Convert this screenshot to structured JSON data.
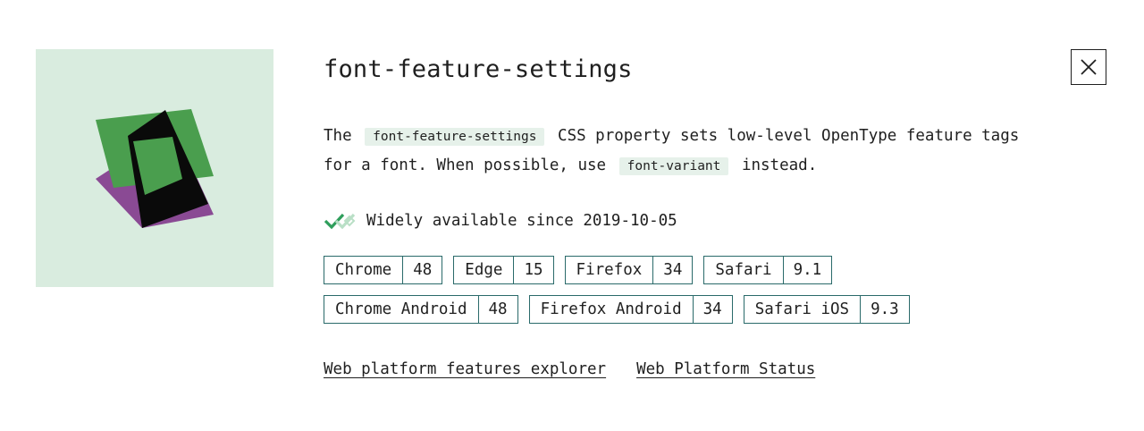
{
  "title": "font-feature-settings",
  "description": {
    "part1": "The",
    "code1": "font-feature-settings",
    "part2": "CSS property sets low-level OpenType feature tags for a font. When possible, use",
    "code2": "font-variant",
    "part3": "instead."
  },
  "status": {
    "text": "Widely available since 2019-10-05",
    "icon": "double-check-icon",
    "color": "#2e9e5b"
  },
  "browsers_row1": [
    {
      "name": "Chrome",
      "version": "48"
    },
    {
      "name": "Edge",
      "version": "15"
    },
    {
      "name": "Firefox",
      "version": "34"
    },
    {
      "name": "Safari",
      "version": "9.1"
    }
  ],
  "browsers_row2": [
    {
      "name": "Chrome Android",
      "version": "48"
    },
    {
      "name": "Firefox Android",
      "version": "34"
    },
    {
      "name": "Safari iOS",
      "version": "9.3"
    }
  ],
  "links": {
    "explorer": "Web platform features explorer",
    "status": "Web Platform Status"
  },
  "close_icon": "close-icon",
  "colors": {
    "illustration_bg": "#d9ecdf",
    "green": "#4a9e4e",
    "purple": "#8a4a94",
    "black": "#0a0a0a",
    "code_bg": "#e6f1ea",
    "chip_border": "#2a6a6a"
  }
}
